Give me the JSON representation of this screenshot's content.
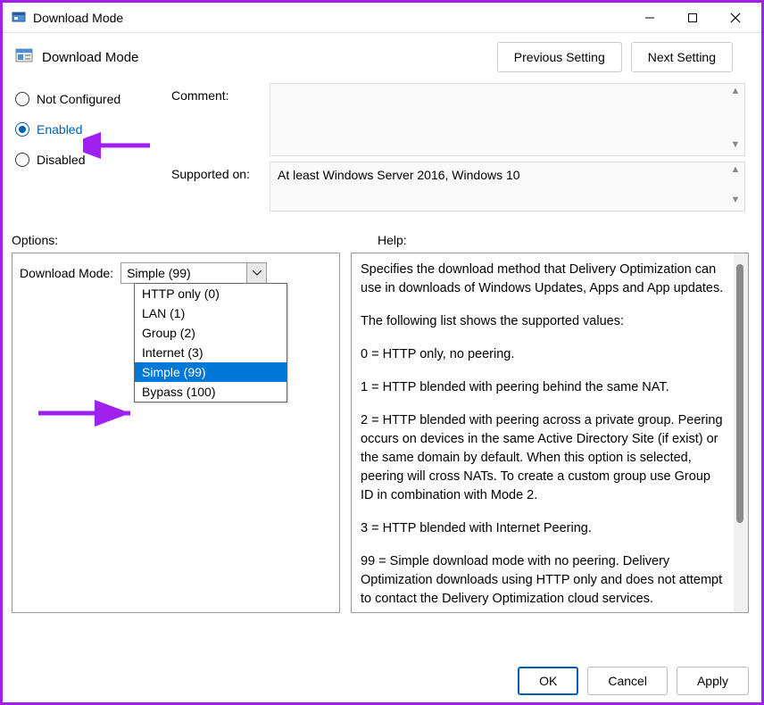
{
  "window": {
    "title": "Download Mode"
  },
  "header": {
    "title": "Download Mode",
    "prev_button": "Previous Setting",
    "next_button": "Next Setting"
  },
  "config": {
    "radios": {
      "not_configured": "Not Configured",
      "enabled": "Enabled",
      "disabled": "Disabled",
      "selected": "enabled"
    },
    "comment_label": "Comment:",
    "comment_value": "",
    "supported_label": "Supported on:",
    "supported_value": "At least Windows Server 2016, Windows 10"
  },
  "panels": {
    "options_label": "Options:",
    "help_label": "Help:"
  },
  "options": {
    "download_mode_label": "Download Mode:",
    "selected_value": "Simple (99)",
    "items": [
      "HTTP only (0)",
      "LAN (1)",
      "Group (2)",
      "Internet (3)",
      "Simple (99)",
      "Bypass (100)"
    ],
    "highlighted_index": 4
  },
  "help": {
    "p1": "Specifies the download method that Delivery Optimization can use in downloads of Windows Updates, Apps and App updates.",
    "p2": "The following list shows the supported values:",
    "p3": "0 = HTTP only, no peering.",
    "p4": "1 = HTTP blended with peering behind the same NAT.",
    "p5": "2 = HTTP blended with peering across a private group. Peering occurs on devices in the same Active Directory Site (if exist) or the same domain by default. When this option is selected, peering will cross NATs. To create a custom group use Group ID in combination with Mode 2.",
    "p6": "3 = HTTP blended with Internet Peering.",
    "p7": "99 = Simple download mode with no peering. Delivery Optimization downloads using HTTP only and does not attempt to contact the Delivery Optimization cloud services."
  },
  "footer": {
    "ok": "OK",
    "cancel": "Cancel",
    "apply": "Apply"
  },
  "annotations": {
    "arrow_color": "#a020f0"
  }
}
